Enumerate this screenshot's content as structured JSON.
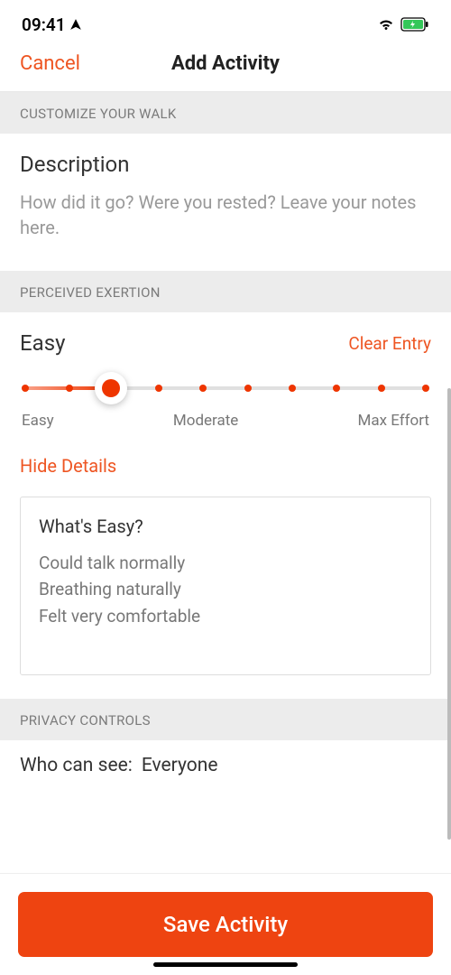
{
  "statusBar": {
    "time": "09:41"
  },
  "navBar": {
    "cancel": "Cancel",
    "title": "Add Activity"
  },
  "sections": {
    "customize": {
      "header": "CUSTOMIZE YOUR WALK",
      "descriptionLabel": "Description",
      "descriptionPlaceholder": "How did it go? Were you rested? Leave your notes here."
    },
    "exertion": {
      "header": "PERCEIVED EXERTION",
      "currentLevel": "Easy",
      "clearEntry": "Clear Entry",
      "sliderLabels": {
        "left": "Easy",
        "center": "Moderate",
        "right": "Max Effort"
      },
      "hideDetails": "Hide Details",
      "detailsTitle": "What's Easy?",
      "detailsLine1": "Could talk normally",
      "detailsLine2": "Breathing naturally",
      "detailsLine3": "Felt very comfortable"
    },
    "privacy": {
      "header": "PRIVACY CONTROLS",
      "label": "Who can see:",
      "value": "Everyone"
    }
  },
  "saveButton": "Save Activity"
}
